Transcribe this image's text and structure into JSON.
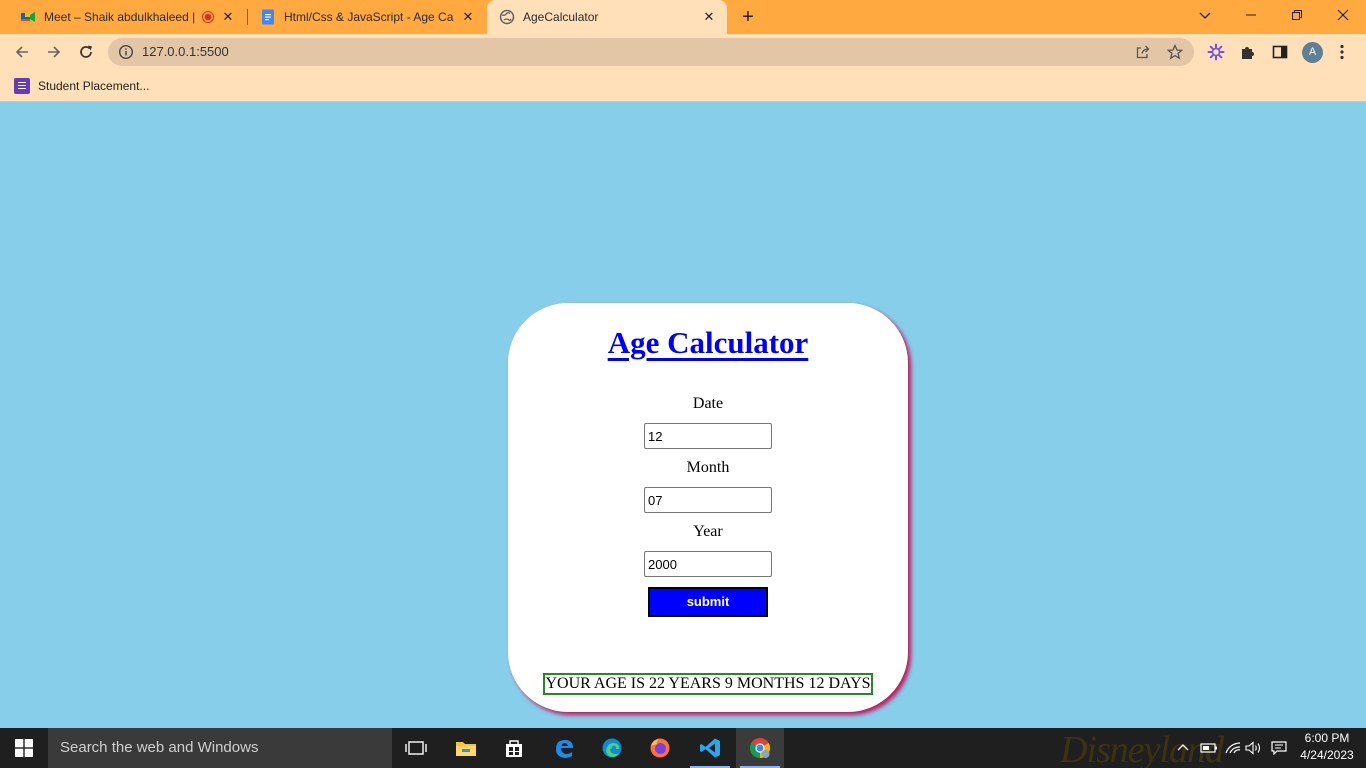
{
  "browser": {
    "tabs": [
      {
        "title": "Meet – Shaik abdulkhaleed |",
        "icon": "google-meet-icon",
        "recording": true
      },
      {
        "title": "Html/Css & JavaScript - Age Calc",
        "icon": "google-docs-icon"
      },
      {
        "title": "AgeCalculator",
        "icon": "globe-icon",
        "active": true
      }
    ],
    "url": "127.0.0.1:5500",
    "bookmarks": [
      {
        "label": "Student Placement..."
      }
    ],
    "profile_initial": "A"
  },
  "page": {
    "title": "Age Calculator",
    "date_label": "Date",
    "date_value": "12",
    "month_label": "Month",
    "month_value": "07",
    "year_label": "Year",
    "year_value": "2000",
    "submit_label": "submit",
    "result": "YOUR AGE IS 22 YEARS 9 MONTHS 12 DAYS"
  },
  "taskbar": {
    "search_placeholder": "Search the web and Windows",
    "time": "6:00 PM",
    "date": "4/24/2023",
    "wallpaper_text": "Disneyland"
  },
  "colors": {
    "page_background": "#87ceeb",
    "tabstrip": "#ffa940",
    "toolbar": "#ffe0b8",
    "title_blue": "#0000ff",
    "card_shadow": "#c2185b",
    "result_border": "#228b22"
  }
}
